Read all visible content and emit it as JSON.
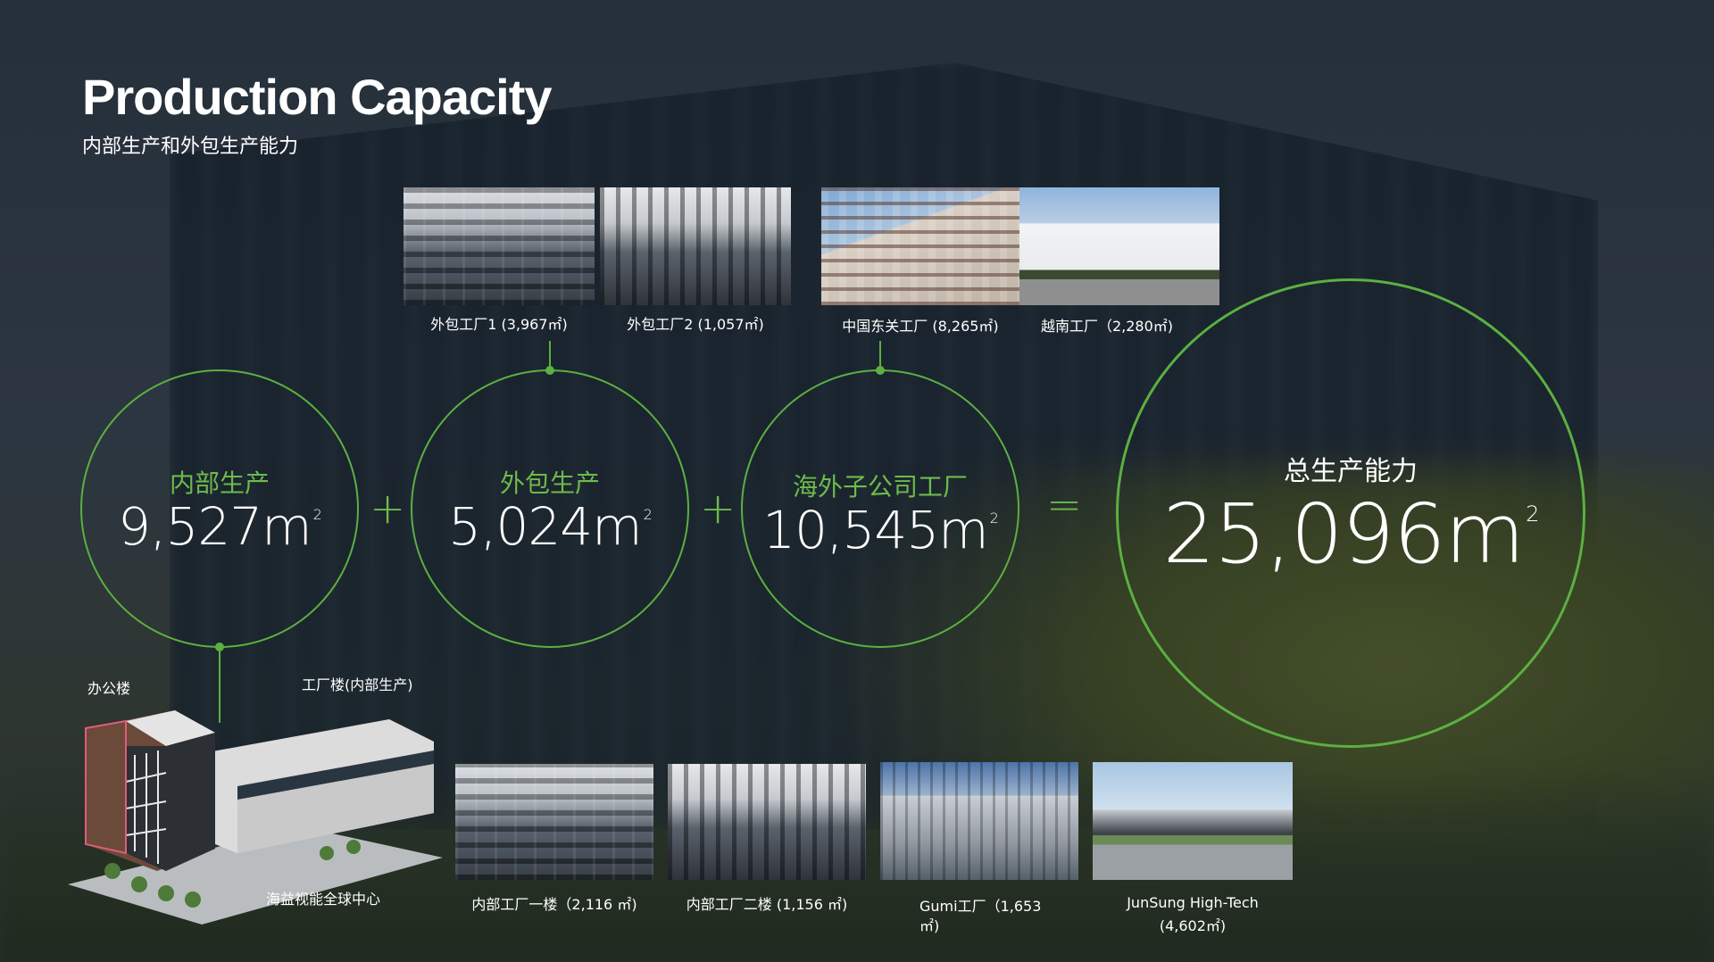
{
  "header": {
    "title": "Production Capacity",
    "subtitle": "内部生产和外包生产能力"
  },
  "circles": [
    {
      "label": "内部生产",
      "value": "9,527",
      "unit": "m",
      "sup": "2"
    },
    {
      "label": "外包生产",
      "value": "5,024",
      "unit": "m",
      "sup": "2"
    },
    {
      "label": "海外子公司工厂",
      "value": "10,545",
      "unit": "m",
      "sup": "2"
    },
    {
      "label": "总生产能力",
      "value": "25,096",
      "unit": "m",
      "sup": "2"
    }
  ],
  "operators": {
    "plus1": "+",
    "plus2": "+",
    "equals": "="
  },
  "top_photos": [
    {
      "caption": "外包工厂1 (3,967㎡)"
    },
    {
      "caption": "外包工厂2 (1,057㎡)"
    },
    {
      "caption": "中国东关工厂 (8,265㎡)"
    },
    {
      "caption": "越南工厂（2,280㎡)"
    }
  ],
  "campus": {
    "office_label": "办公楼",
    "factory_label": "工厂楼(内部生产)",
    "center_label": "海益视能全球中心"
  },
  "bottom_photos": [
    {
      "caption": "内部工厂一楼（2,116 ㎡)"
    },
    {
      "caption": "内部工厂二楼 (1,156 ㎡)"
    },
    {
      "caption_line1": "Gumi工厂（1,653",
      "caption_line2": "㎡)"
    },
    {
      "caption_line1": "JunSung High-Tech",
      "caption_line2": "(4,602㎡)"
    }
  ],
  "colors": {
    "accent": "#5bb041",
    "label_green": "#6dbb4b"
  }
}
